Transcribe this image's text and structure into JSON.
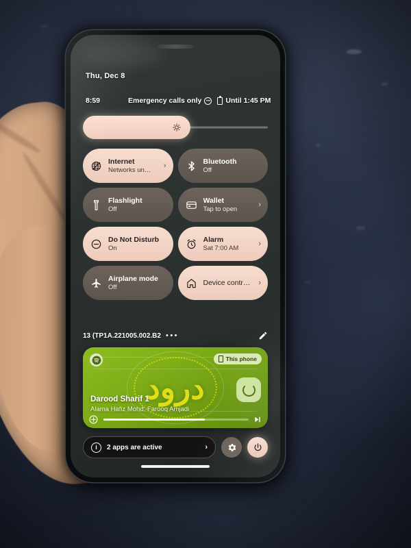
{
  "statusbar": {
    "date": "Thu, Dec 8",
    "clock": "8:59",
    "carrier": "Emergency calls only",
    "dnd_icon": "do-not-disturb-icon",
    "battery_icon": "battery-icon",
    "battery_estimate": "Until 1:45 PM"
  },
  "brightness": {
    "label": "brightness-slider",
    "level_percent": 58,
    "icon": "brightness-sun-icon"
  },
  "tiles": [
    {
      "title": "Internet",
      "subtitle": "Networks un…",
      "state": "on",
      "icon": "internet-off-icon",
      "chevron": true,
      "name": "tile-internet"
    },
    {
      "title": "Bluetooth",
      "subtitle": "Off",
      "state": "off",
      "icon": "bluetooth-icon",
      "chevron": false,
      "name": "tile-bluetooth"
    },
    {
      "title": "Flashlight",
      "subtitle": "Off",
      "state": "off",
      "icon": "flashlight-icon",
      "chevron": false,
      "name": "tile-flashlight"
    },
    {
      "title": "Wallet",
      "subtitle": "Tap to open",
      "state": "off",
      "icon": "wallet-icon",
      "chevron": true,
      "name": "tile-wallet"
    },
    {
      "title": "Do Not Disturb",
      "subtitle": "On",
      "state": "on",
      "icon": "do-not-disturb-icon",
      "chevron": false,
      "name": "tile-do-not-disturb"
    },
    {
      "title": "Alarm",
      "subtitle": "Sat 7:00 AM",
      "state": "on",
      "icon": "alarm-icon",
      "chevron": true,
      "name": "tile-alarm"
    },
    {
      "title": "Airplane mode",
      "subtitle": "Off",
      "state": "off",
      "icon": "airplane-icon",
      "chevron": false,
      "name": "tile-airplane-mode"
    },
    {
      "title": "Device contr…",
      "subtitle": "",
      "state": "on",
      "icon": "home-icon",
      "chevron": true,
      "name": "tile-device-controls"
    }
  ],
  "footer": {
    "build": "13 (TP1A.221005.002.B2",
    "overflow_dots": "•••",
    "edit_icon": "pencil-icon"
  },
  "media": {
    "app_icon": "spotify-icon",
    "output_chip": "This phone",
    "output_chip_icon": "phone-icon",
    "title": "Darood Sharif 1",
    "artist": "Alama Hafiz Mohd. Farooq Amjadi",
    "artwork_text": "درود",
    "play_state_icon": "loading-spinner-icon",
    "add_icon": "add-to-library-icon",
    "next_icon": "next-track-icon",
    "progress_percent": 70
  },
  "bottom": {
    "active_apps": "2 apps are active",
    "info_icon": "info-icon",
    "chevron_icon": "chevron-right-icon",
    "settings_icon": "gear-icon",
    "power_icon": "power-icon"
  },
  "colors": {
    "tile_on": "#f2d4c6",
    "tile_off": "#675e58",
    "media_green": "#7fae18",
    "accent_pink": "#f6ddd0"
  }
}
